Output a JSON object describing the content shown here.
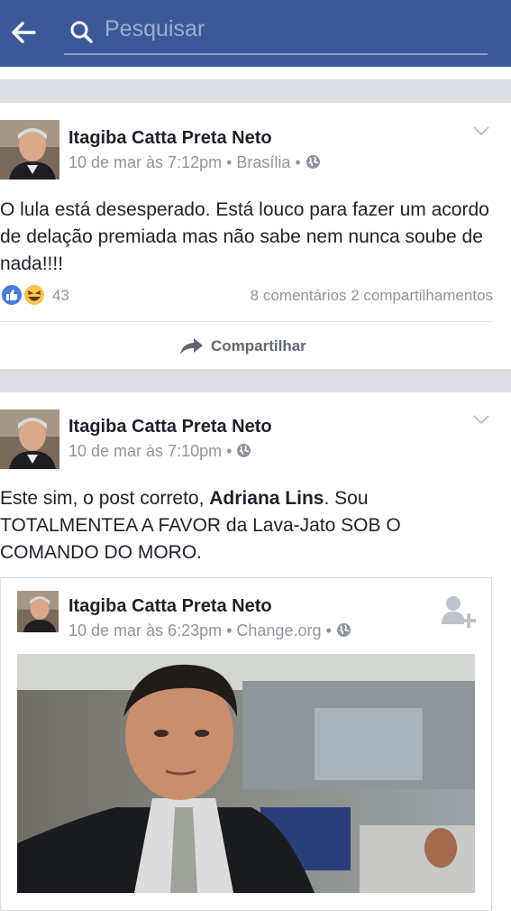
{
  "search": {
    "placeholder": "Pesquisar"
  },
  "posts": [
    {
      "author": "Itagiba Catta Preta Neto",
      "meta": "10 de mar às 7:12pm • Brasília •",
      "text": "O lula está desesperado. Está louco para fazer um acordo de delação premiada mas não sabe nem nunca soube de nada!!!!",
      "reaction_count": "43",
      "comments": "8 comentários",
      "shares": "2 compartilhamentos",
      "share_label": "Compartilhar"
    },
    {
      "author": "Itagiba Catta Preta Neto",
      "meta": "10 de mar às 7:10pm •",
      "text_before": "Este sim, o post correto, ",
      "text_mention": "Adriana Lins",
      "text_after": ". Sou TOTALMENTEA A FAVOR da Lava-Jato SOB O COMANDO DO MORO.",
      "shared": {
        "author": "Itagiba Catta Preta Neto",
        "meta": "10 de mar às 6:23pm • Change.org •"
      }
    }
  ],
  "colors": {
    "brand": "#3b5998",
    "separator": "#dcdee3",
    "meta_text": "#90949c"
  },
  "icons": [
    "back-arrow-icon",
    "search-icon",
    "chevron-down-icon",
    "globe-icon",
    "like-icon",
    "haha-icon",
    "share-arrow-icon",
    "add-friend-icon"
  ]
}
